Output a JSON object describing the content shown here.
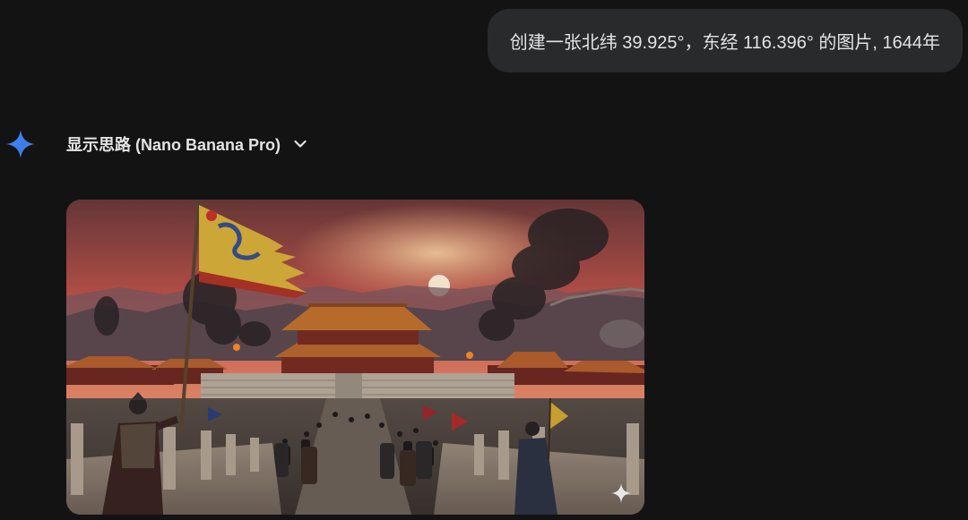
{
  "conversation": {
    "user_prompt": "创建一张北纬 39.925°，东经 116.396° 的图片, 1644年",
    "response": {
      "model_icon": "gemini-sparkle-icon",
      "thoughts_label": "显示思路 (Nano Banana Pro)",
      "toggle_icon": "chevron-down-icon",
      "image": {
        "subject": "generated-image",
        "watermark_icon": "sparkle-watermark-icon"
      }
    }
  },
  "colors": {
    "background": "#131314",
    "bubble": "#282a2c",
    "text": "#e3e3e3",
    "accent_blue": "#4c8df6"
  }
}
